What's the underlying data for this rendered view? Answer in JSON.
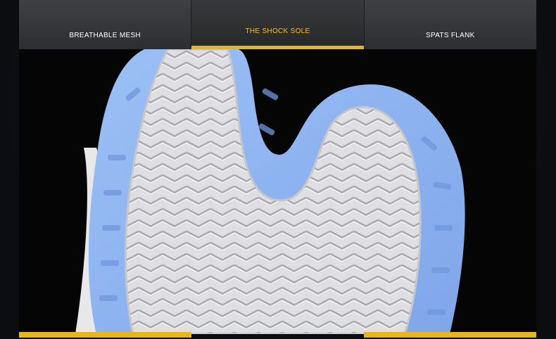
{
  "tabs": [
    {
      "label": "BREATHABLE MESH",
      "active": false
    },
    {
      "label": "THE SHOCK SOLE",
      "active": true
    },
    {
      "label": "SPATS FLANK",
      "active": false
    }
  ],
  "colors": {
    "accent": "#e9b618",
    "active_text": "#f2c21b",
    "tab_bg": "#36383b",
    "sole_blue": "#8fb3ef",
    "sole_white": "#e6e6e8"
  },
  "image": {
    "subject": "sneaker-outsole"
  }
}
